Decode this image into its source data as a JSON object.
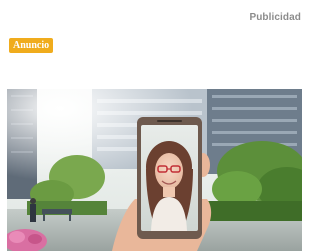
{
  "header": {
    "publicidad_label": "Publicidad"
  },
  "badge": {
    "label": "Anuncio",
    "color": "#f0ac1d"
  },
  "ad_image": {
    "description_icon": "photo-icon"
  },
  "colors": {
    "label_gray": "#8c8c8c",
    "badge_orange": "#f0ac1d"
  }
}
